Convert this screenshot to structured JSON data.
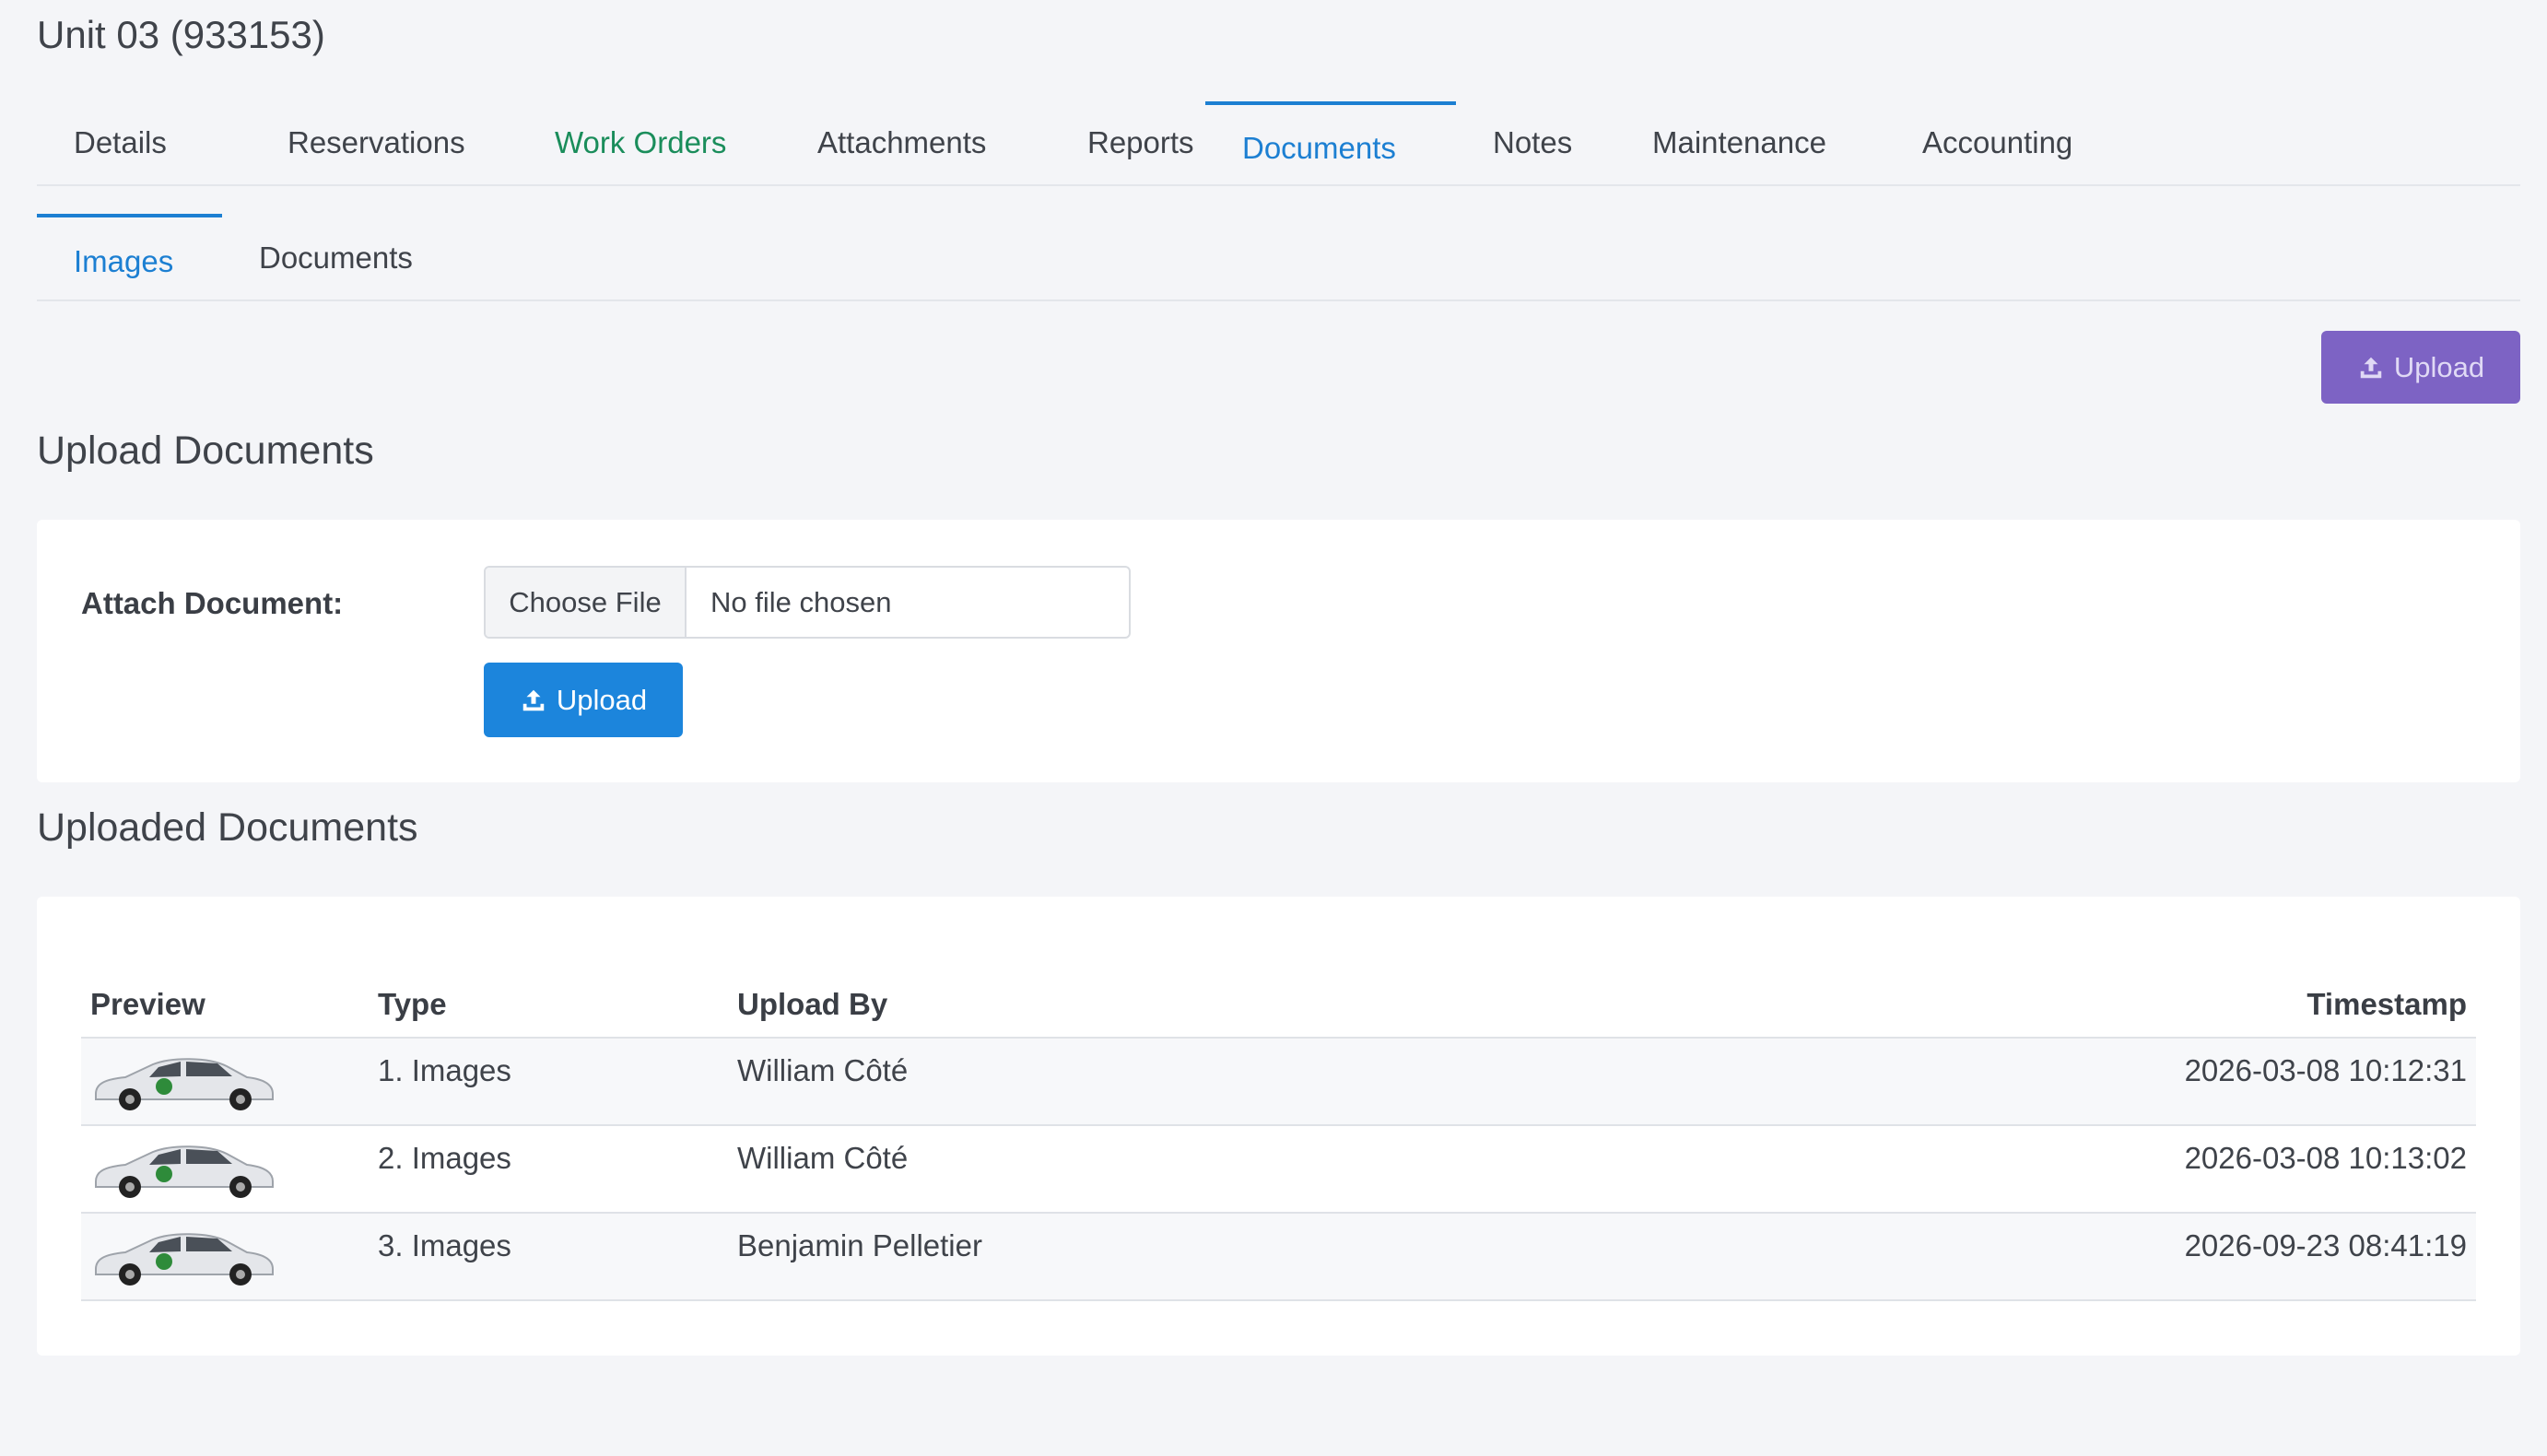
{
  "header": {
    "title": "Unit 03 (933153)"
  },
  "tabs": [
    {
      "label": "Details"
    },
    {
      "label": "Reservations"
    },
    {
      "label": "Work Orders"
    },
    {
      "label": "Attachments"
    },
    {
      "label": "Reports"
    },
    {
      "label": "Documents"
    },
    {
      "label": "Notes"
    },
    {
      "label": "Maintenance"
    },
    {
      "label": "Accounting"
    }
  ],
  "subtabs": [
    {
      "label": "Images"
    },
    {
      "label": "Documents"
    }
  ],
  "toolbar": {
    "upload_label": "Upload"
  },
  "upload_section": {
    "title": "Upload Documents",
    "attach_label": "Attach Document:",
    "choose_file_label": "Choose File",
    "no_file_label": "No file chosen",
    "upload_label": "Upload"
  },
  "uploaded_section": {
    "title": "Uploaded Documents",
    "columns": {
      "preview": "Preview",
      "type": "Type",
      "upload_by": "Upload By",
      "timestamp": "Timestamp"
    },
    "rows": [
      {
        "type": "1. Images",
        "upload_by": "William Côté",
        "timestamp": "2026-03-08 10:12:31"
      },
      {
        "type": "2. Images",
        "upload_by": "William Côté",
        "timestamp": "2026-03-08 10:13:02"
      },
      {
        "type": "3. Images",
        "upload_by": "Benjamin Pelletier",
        "timestamp": "2026-09-23 08:41:19"
      }
    ]
  },
  "colors": {
    "accent": "#1c7fd2",
    "green_tab": "#1a8d5b",
    "upload_top": "#7d63c4",
    "upload": "#1c85dc"
  },
  "icons": {
    "upload": "upload-icon",
    "preview": "car-thumbnail"
  }
}
